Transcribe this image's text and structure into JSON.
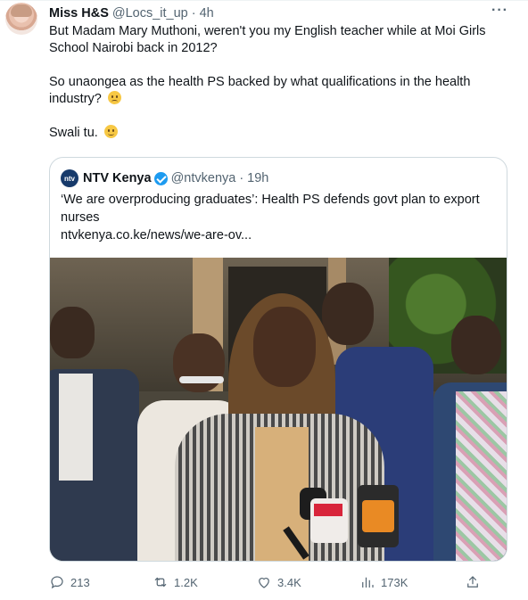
{
  "tweet": {
    "name": "Miss H&S",
    "handle": "@Locs_it_up",
    "dot": "·",
    "time": "4h",
    "more_icon": "more-horizontal-icon",
    "paragraph1": "But Madam Mary Muthoni, weren't you my English teacher while at Moi Girls School Nairobi back in 2012?",
    "paragraph2": "So unaongea as the health PS backed by what qualifications in the health industry?",
    "paragraph3": "Swali tu."
  },
  "quote": {
    "logo_text": "ntv",
    "name": "NTV Kenya",
    "handle": "@ntvkenya",
    "dot": "·",
    "time": "19h",
    "text": "‘We are overproducing graduates’: Health PS defends govt plan to export nurses",
    "link": "ntvkenya.co.ke/news/we-are-ov..."
  },
  "actions": {
    "replies": "213",
    "reposts": "1.2K",
    "likes": "3.4K",
    "views": "173K"
  },
  "colors": {
    "text": "#0f1419",
    "secondary": "#536471",
    "verified": "#1d9bf0",
    "border": "#cfd9de"
  }
}
